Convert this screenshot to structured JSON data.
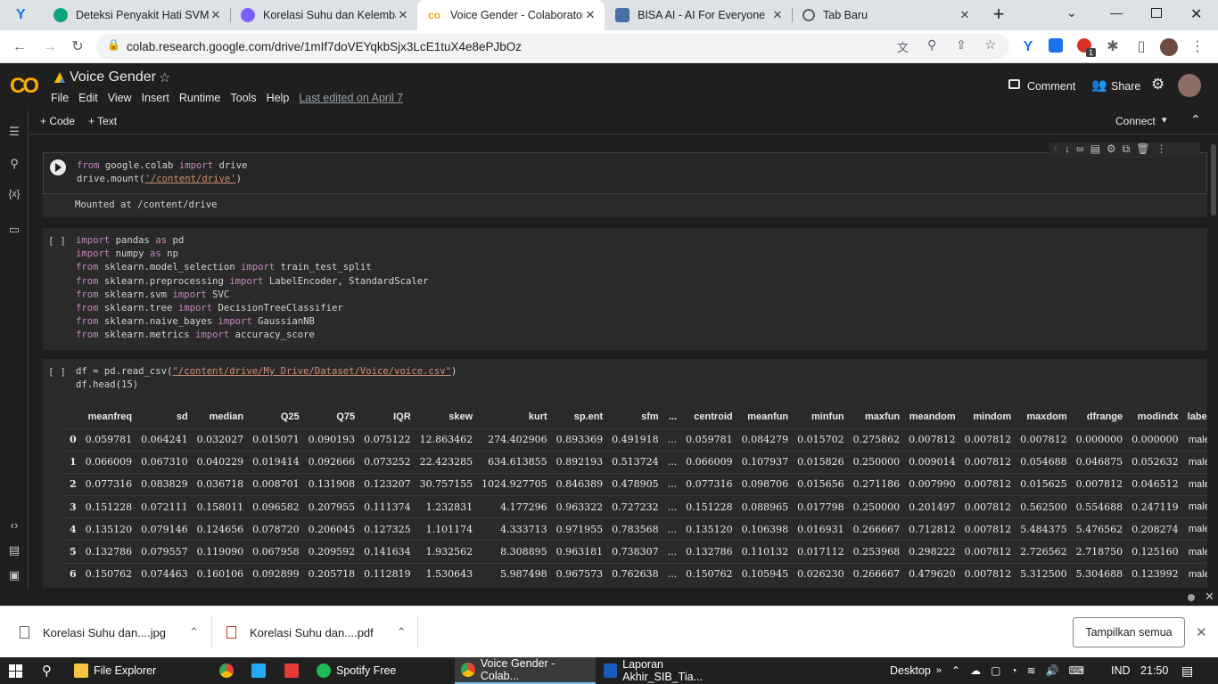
{
  "browser": {
    "tabs": [
      {
        "title": "Deteksi Penyakit Hati SVM",
        "active": false
      },
      {
        "title": "Korelasi Suhu dan Kelemba",
        "active": false
      },
      {
        "title": "Voice Gender - Colaborator",
        "active": true
      },
      {
        "title": "BISA AI - AI For Everyone",
        "active": false
      },
      {
        "title": "Tab Baru",
        "active": false
      }
    ],
    "url": "colab.research.google.com/drive/1mIf7doVEYqkbSjx3LcE1tuX4e8ePJbOz",
    "ext_badge": "1"
  },
  "colab": {
    "title": "Voice Gender",
    "menu": [
      "File",
      "Edit",
      "View",
      "Insert",
      "Runtime",
      "Tools",
      "Help"
    ],
    "last_edited": "Last edited on April 7",
    "comment": "Comment",
    "share": "Share",
    "add_code": "+ Code",
    "add_text": "+ Text",
    "connect": "Connect"
  },
  "cells": {
    "c1_bracket": "",
    "c1_output": "Mounted at /content/drive",
    "c2_bracket": "[ ]",
    "c3_bracket": "[ ]"
  },
  "dataframe": {
    "columns": [
      "",
      "meanfreq",
      "sd",
      "median",
      "Q25",
      "Q75",
      "IQR",
      "skew",
      "kurt",
      "sp.ent",
      "sfm",
      "...",
      "centroid",
      "meanfun",
      "minfun",
      "maxfun",
      "meandom",
      "mindom",
      "maxdom",
      "dfrange",
      "modindx",
      "label"
    ],
    "rows": [
      [
        "0",
        "0.059781",
        "0.064241",
        "0.032027",
        "0.015071",
        "0.090193",
        "0.075122",
        "12.863462",
        "274.402906",
        "0.893369",
        "0.491918",
        "...",
        "0.059781",
        "0.084279",
        "0.015702",
        "0.275862",
        "0.007812",
        "0.007812",
        "0.007812",
        "0.000000",
        "0.000000",
        "male"
      ],
      [
        "1",
        "0.066009",
        "0.067310",
        "0.040229",
        "0.019414",
        "0.092666",
        "0.073252",
        "22.423285",
        "634.613855",
        "0.892193",
        "0.513724",
        "...",
        "0.066009",
        "0.107937",
        "0.015826",
        "0.250000",
        "0.009014",
        "0.007812",
        "0.054688",
        "0.046875",
        "0.052632",
        "male"
      ],
      [
        "2",
        "0.077316",
        "0.083829",
        "0.036718",
        "0.008701",
        "0.131908",
        "0.123207",
        "30.757155",
        "1024.927705",
        "0.846389",
        "0.478905",
        "...",
        "0.077316",
        "0.098706",
        "0.015656",
        "0.271186",
        "0.007990",
        "0.007812",
        "0.015625",
        "0.007812",
        "0.046512",
        "male"
      ],
      [
        "3",
        "0.151228",
        "0.072111",
        "0.158011",
        "0.096582",
        "0.207955",
        "0.111374",
        "1.232831",
        "4.177296",
        "0.963322",
        "0.727232",
        "...",
        "0.151228",
        "0.088965",
        "0.017798",
        "0.250000",
        "0.201497",
        "0.007812",
        "0.562500",
        "0.554688",
        "0.247119",
        "male"
      ],
      [
        "4",
        "0.135120",
        "0.079146",
        "0.124656",
        "0.078720",
        "0.206045",
        "0.127325",
        "1.101174",
        "4.333713",
        "0.971955",
        "0.783568",
        "...",
        "0.135120",
        "0.106398",
        "0.016931",
        "0.266667",
        "0.712812",
        "0.007812",
        "5.484375",
        "5.476562",
        "0.208274",
        "male"
      ],
      [
        "5",
        "0.132786",
        "0.079557",
        "0.119090",
        "0.067958",
        "0.209592",
        "0.141634",
        "1.932562",
        "8.308895",
        "0.963181",
        "0.738307",
        "...",
        "0.132786",
        "0.110132",
        "0.017112",
        "0.253968",
        "0.298222",
        "0.007812",
        "2.726562",
        "2.718750",
        "0.125160",
        "male"
      ],
      [
        "6",
        "0.150762",
        "0.074463",
        "0.160106",
        "0.092899",
        "0.205718",
        "0.112819",
        "1.530643",
        "5.987498",
        "0.967573",
        "0.762638",
        "...",
        "0.150762",
        "0.105945",
        "0.026230",
        "0.266667",
        "0.479620",
        "0.007812",
        "5.312500",
        "5.304688",
        "0.123992",
        "male"
      ]
    ]
  },
  "downloads": {
    "items": [
      "Korelasi Suhu dan....jpg",
      "Korelasi Suhu dan....pdf"
    ],
    "show_all": "Tampilkan semua"
  },
  "taskbar": {
    "apps": [
      "File Explorer",
      "Spotify Free",
      "Voice Gender - Colab...",
      "Laporan Akhir_SIB_Tia..."
    ],
    "desktop": "Desktop",
    "lang": "IND",
    "time": "21:50"
  },
  "colors": {
    "colab_orange": "#f9ab00",
    "keyword": "#c586c0",
    "string": "#ce9178"
  }
}
